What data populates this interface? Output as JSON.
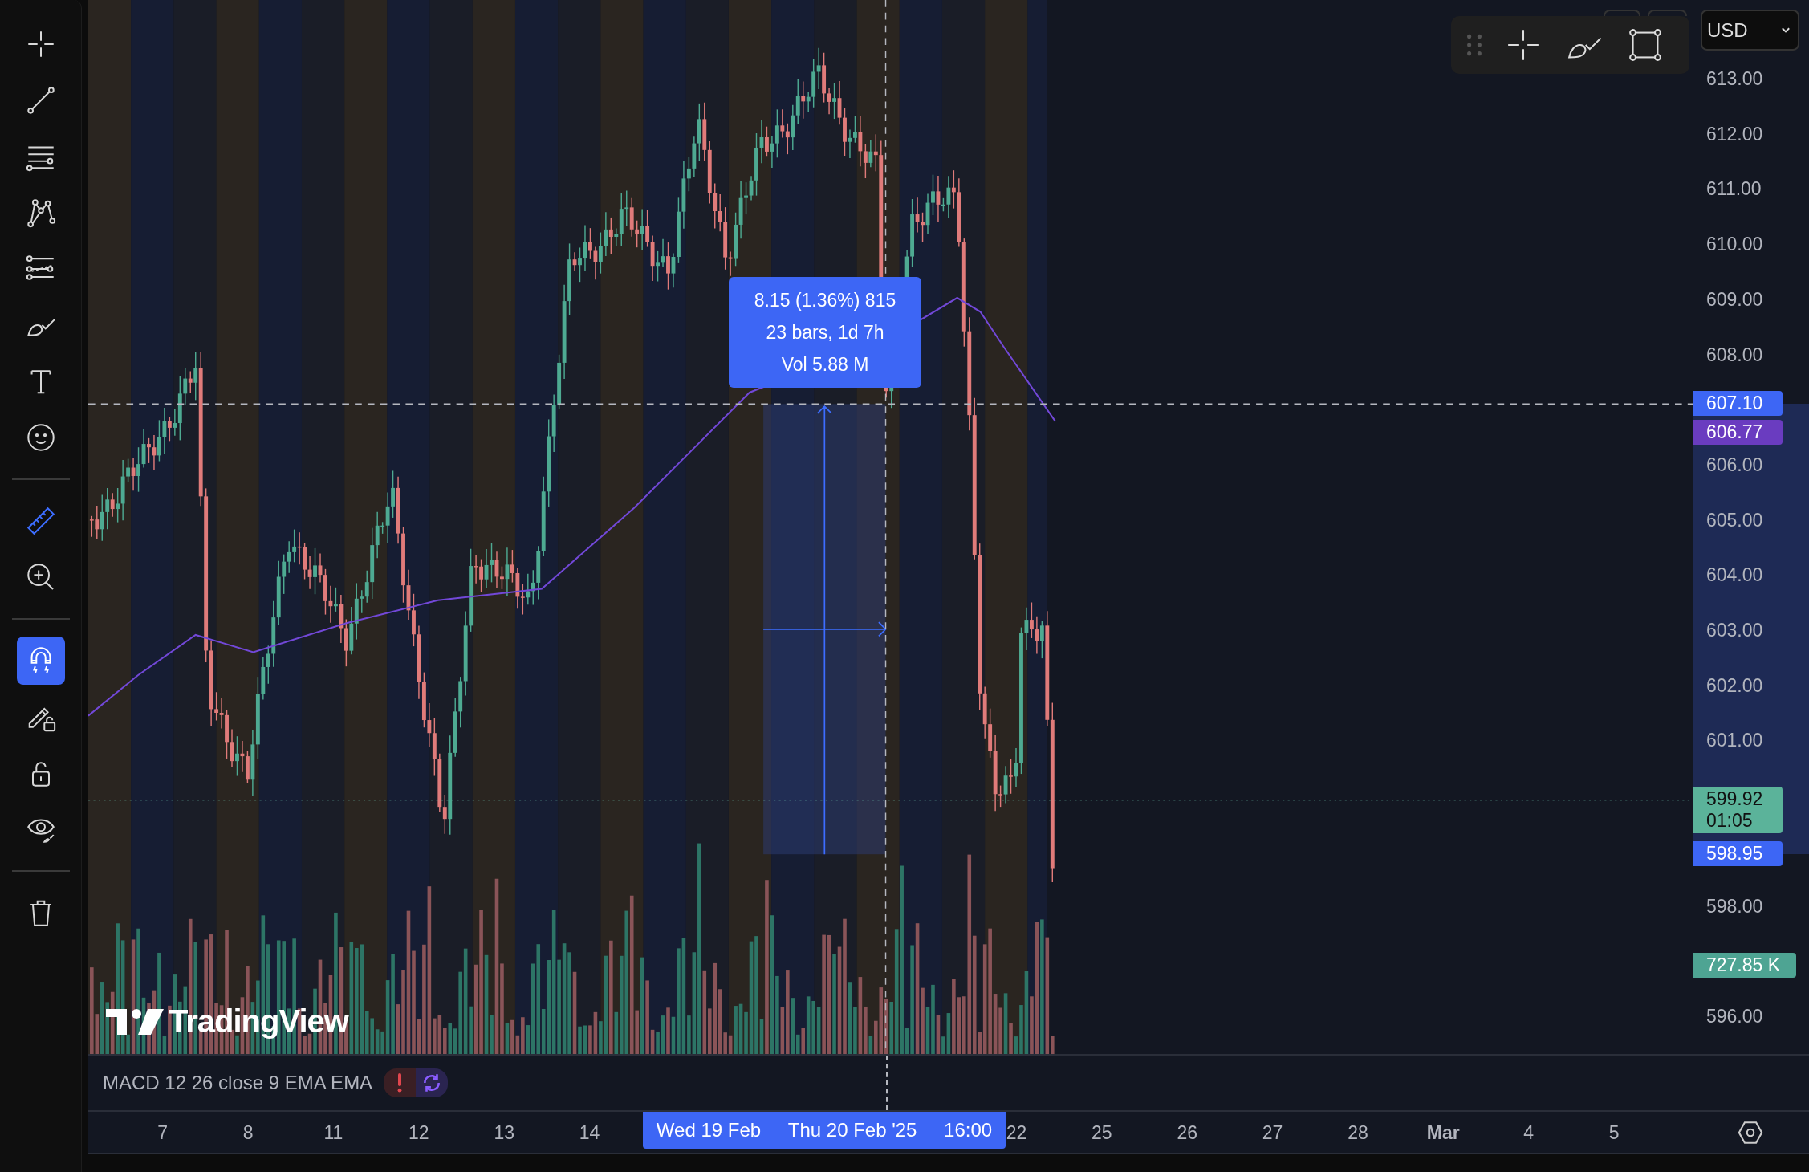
{
  "drawing_toolbar": {
    "groups": [
      [
        {
          "kind": "crosshair",
          "selected": false,
          "on": false
        },
        {
          "kind": "trend-line",
          "selected": false,
          "on": false
        },
        {
          "kind": "horizontal-lines",
          "selected": false,
          "on": false
        },
        {
          "kind": "pattern",
          "selected": false,
          "on": false
        },
        {
          "kind": "fib",
          "selected": false,
          "on": false
        },
        {
          "kind": "brush",
          "selected": false,
          "on": false
        },
        {
          "kind": "text",
          "selected": false,
          "on": false
        },
        {
          "kind": "emoji",
          "selected": false,
          "on": false
        }
      ],
      [
        {
          "kind": "ruler",
          "selected": true,
          "on": false
        },
        {
          "kind": "zoom",
          "selected": false,
          "on": false
        }
      ],
      [
        {
          "kind": "magnet",
          "selected": false,
          "on": true
        },
        {
          "kind": "lock-drawing",
          "selected": false,
          "on": false
        },
        {
          "kind": "lock",
          "selected": false,
          "on": false
        },
        {
          "kind": "eye",
          "selected": false,
          "on": false
        }
      ],
      [
        {
          "kind": "trash",
          "selected": false,
          "on": false
        }
      ]
    ]
  },
  "currency_select": {
    "value": "USD"
  },
  "measure_tooltip": {
    "lines": [
      "8.15 (1.36%) 815",
      "23 bars, 1d 7h",
      "Vol 5.88 M"
    ]
  },
  "watermark": {
    "text": "TradingView"
  },
  "price_axis": {
    "ticks": [
      "613.00",
      "612.00",
      "611.00",
      "610.00",
      "609.00",
      "608.00",
      "606.00",
      "605.00",
      "604.00",
      "603.00",
      "602.00",
      "601.00",
      "598.00",
      "596.00"
    ],
    "labels": [
      {
        "kind": "crosshair",
        "lines": [
          "607.10"
        ]
      },
      {
        "kind": "ema",
        "lines": [
          "606.77"
        ]
      },
      {
        "kind": "last",
        "lines": [
          "599.92",
          "01:05"
        ]
      },
      {
        "kind": "measure",
        "lines": [
          "598.95"
        ]
      },
      {
        "kind": "volume",
        "lines": [
          "727.85 K"
        ]
      }
    ]
  },
  "indicator_legend": {
    "text": "MACD 12 26 close 9 EMA EMA",
    "error": true
  },
  "time_axis": {
    "ticks": [
      {
        "label": "7",
        "kind": "day"
      },
      {
        "label": "8",
        "kind": "day"
      },
      {
        "label": "11",
        "kind": "day"
      },
      {
        "label": "12",
        "kind": "day"
      },
      {
        "label": "13",
        "kind": "day"
      },
      {
        "label": "14",
        "kind": "day"
      },
      {
        "label": "22",
        "kind": "day"
      },
      {
        "label": "25",
        "kind": "day"
      },
      {
        "label": "26",
        "kind": "day"
      },
      {
        "label": "27",
        "kind": "day"
      },
      {
        "label": "28",
        "kind": "day"
      },
      {
        "label": "Mar",
        "kind": "month"
      },
      {
        "label": "4",
        "kind": "day"
      },
      {
        "label": "5",
        "kind": "day"
      }
    ],
    "crosshair_labels": [
      "Wed 19 Feb",
      "Thu 20 Feb '25",
      "16:00"
    ]
  }
}
